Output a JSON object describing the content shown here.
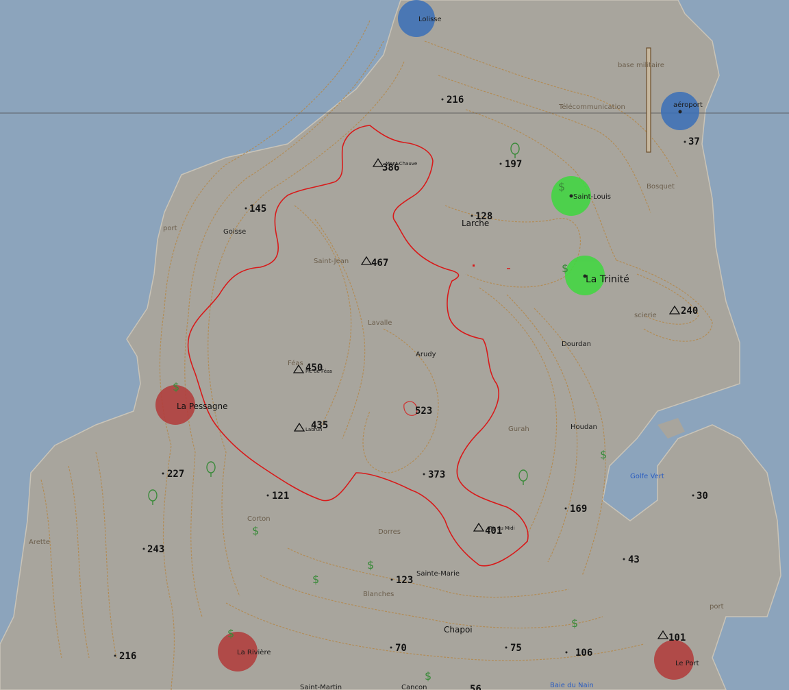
{
  "colors": {
    "sea": "#8ca4bc",
    "land": "#a8a59d",
    "contour": "#b4884a",
    "boundary": "#d81a1a",
    "zone_blue": "#3a6fb8",
    "zone_green": "#3ed83e",
    "zone_red": "#b23a3a",
    "tree": "#3a8a3a",
    "text_dark": "#1a1a1a",
    "text_dim": "#6b5e4c",
    "water_text": "#2a5cc0"
  },
  "zones": [
    {
      "name": "Lolisse",
      "color": "blue"
    },
    {
      "name": "aéroport",
      "color": "blue"
    },
    {
      "name": "Saint-Louis",
      "color": "green"
    },
    {
      "name": "La Trinité",
      "color": "green"
    },
    {
      "name": "La Pessagne",
      "color": "red"
    },
    {
      "name": "La Rivière",
      "color": "red"
    },
    {
      "name": "Le Port",
      "color": "red"
    }
  ],
  "places": {
    "lolisse": "Lolisse",
    "base_militaire": "base militaire",
    "telecommunication": "Télécommunication",
    "aeroport": "aéroport",
    "bosquet": "Bosquet",
    "saint_louis": "Saint-Louis",
    "larche": "Larche",
    "la_trinite": "La Trinité",
    "port_west": "port",
    "goisse": "Goisse",
    "saint_jean": "Saint-Jean",
    "lavalle": "Lavalle",
    "arudy": "Arudy",
    "feas": "Féas",
    "dourdan": "Dourdan",
    "scierie": "scierie",
    "la_pessagne": "La Pessagne",
    "gurah": "Gurah",
    "houdan": "Houdan",
    "golfe_vert": "Golfe Vert",
    "corton": "Corton",
    "arette": "Arette",
    "dorres": "Dorres",
    "sainte_marie": "Sainte-Marie",
    "blanches": "Blanches",
    "chapoi": "Chapoi",
    "port_east": "port",
    "la_riviere": "La Rivière",
    "le_port": "Le Port",
    "baie_du_nain": "Baie du Nain",
    "cancon": "Cancon",
    "saint_martin": "Saint-Martin"
  },
  "peaks": {
    "mont_chauve": "Mont Chauve",
    "feas_peak": "Pic de Féas",
    "peak_435": "Labrun",
    "pic_midi": "Pic du Midi"
  },
  "altitudes": {
    "a216n": "216",
    "a386": "386",
    "a197": "197",
    "a37": "37",
    "a145": "145",
    "a128": "128",
    "a467": "467",
    "a240": "240",
    "a450": "450",
    "a523": "523",
    "a435": "435",
    "a373": "373",
    "a227": "227",
    "a121": "121",
    "a169": "169",
    "a30": "30",
    "a401": "401",
    "a243": "243",
    "a43": "43",
    "a123": "123",
    "a101": "101",
    "a70": "70",
    "a75": "75",
    "a106": "106",
    "a216s": "216",
    "a56": "56"
  },
  "icons": [
    "mountain-peak-icon",
    "tree-icon",
    "dollar-icon",
    "runway-icon"
  ]
}
